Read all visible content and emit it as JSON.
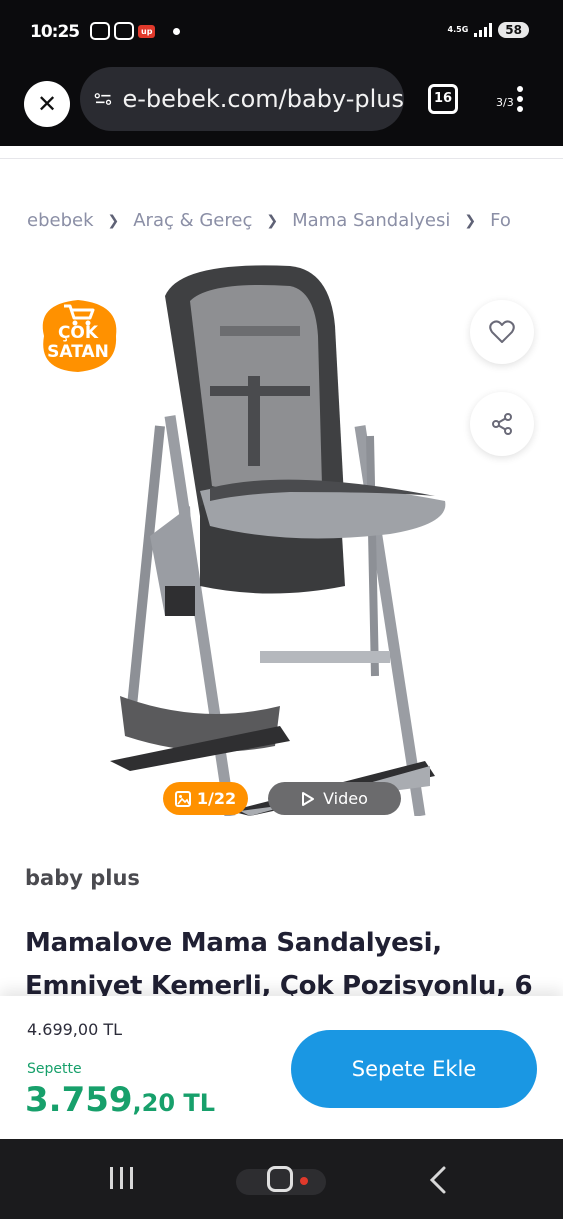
{
  "status_bar": {
    "time": "10:25",
    "badge": "up",
    "network": "4.5G",
    "battery": "58"
  },
  "browser": {
    "url": "e-bebek.com/baby-plus",
    "tab_count": "16",
    "page_indicator": "3/3",
    "icons": [
      "close-icon",
      "site-settings-icon",
      "tabs-icon",
      "more-vert-icon"
    ]
  },
  "breadcrumb": [
    "ebebek",
    "Araç & Gereç",
    "Mama Sandalyesi",
    "Fo"
  ],
  "product": {
    "badge_line1": "ÇOK",
    "badge_line2": "SATAN",
    "image_counter": "1/22",
    "video_label": "Video",
    "brand": "baby plus",
    "title": "Mamalove Mama Sandalyesi, Emniyet Kemerli, Çok Pozisyonlu, 6"
  },
  "pricing": {
    "old_price": "4.699,00 TL",
    "sepette_label": "Sepette",
    "new_price_main": "3.759",
    "new_price_rest": ",20 TL",
    "add_to_cart": "Sepete Ekle"
  },
  "colors": {
    "accent_blue": "#1a97e3",
    "price_green": "#17a06b",
    "badge_orange": "#ff9100"
  }
}
